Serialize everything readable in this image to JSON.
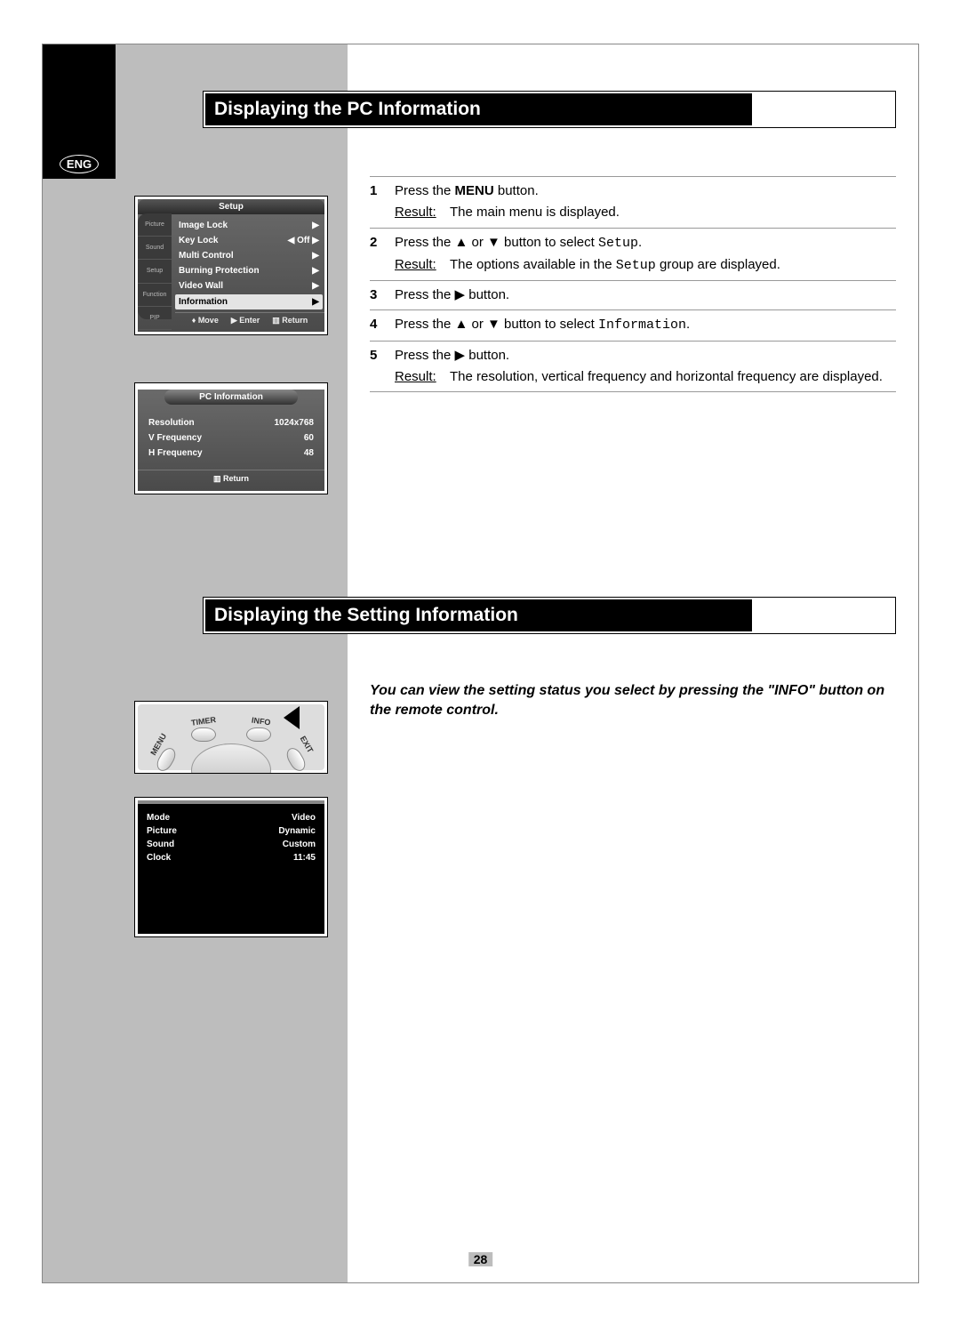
{
  "lang_badge": "ENG",
  "page_number": "28",
  "section1": {
    "title": "Displaying the PC Information",
    "steps": [
      {
        "num": "1",
        "text_parts": [
          "Press the ",
          "MENU",
          " button."
        ],
        "result": "The main menu is displayed."
      },
      {
        "num": "2",
        "text_parts": [
          "Press the ▲ or ▼ button to select ",
          "Setup",
          "."
        ],
        "result_parts": [
          "The options available in the ",
          "Setup",
          " group are displayed."
        ]
      },
      {
        "num": "3",
        "text_parts": [
          "Press the ▶ button."
        ]
      },
      {
        "num": "4",
        "text_parts": [
          "Press the ▲ or ▼ button to select ",
          "Information",
          "."
        ]
      },
      {
        "num": "5",
        "text_parts": [
          "Press the ▶ button."
        ],
        "result": "The resolution, vertical frequency and horizontal frequency are displayed."
      }
    ],
    "result_label": "Result:"
  },
  "osd_setup": {
    "title": "Setup",
    "side_tabs": [
      "Picture",
      "Sound",
      "Setup",
      "Function",
      "PIP"
    ],
    "rows": [
      {
        "label": "Image Lock",
        "value": "▶"
      },
      {
        "label": "Key Lock",
        "value": "◀ Off ▶"
      },
      {
        "label": "Multi Control",
        "value": "▶"
      },
      {
        "label": "Burning Protection",
        "value": "▶"
      },
      {
        "label": "Video Wall",
        "value": "▶"
      },
      {
        "label": "Information",
        "value": "▶",
        "selected": true
      }
    ],
    "footer": {
      "move": "Move",
      "enter": "Enter",
      "return": "Return"
    }
  },
  "osd_pcinfo": {
    "title": "PC Information",
    "rows": [
      {
        "label": "Resolution",
        "value": "1024x768"
      },
      {
        "label": "V  Frequency",
        "value": "60"
      },
      {
        "label": "H  Frequency",
        "value": "48"
      }
    ],
    "footer": "Return"
  },
  "section2": {
    "title": "Displaying the Setting Information",
    "intro": "You can view the setting status you select by pressing the \"INFO\" button on the remote control."
  },
  "remote": {
    "labels": {
      "menu": "MENU",
      "timer": "TIMER",
      "info": "INFO",
      "exit": "EXIT"
    }
  },
  "info_overlay": {
    "rows": [
      {
        "label": "Mode",
        "value": "Video"
      },
      {
        "label": "Picture",
        "value": "Dynamic"
      },
      {
        "label": "Sound",
        "value": "Custom"
      },
      {
        "label": "Clock",
        "value": "11:45"
      }
    ]
  }
}
